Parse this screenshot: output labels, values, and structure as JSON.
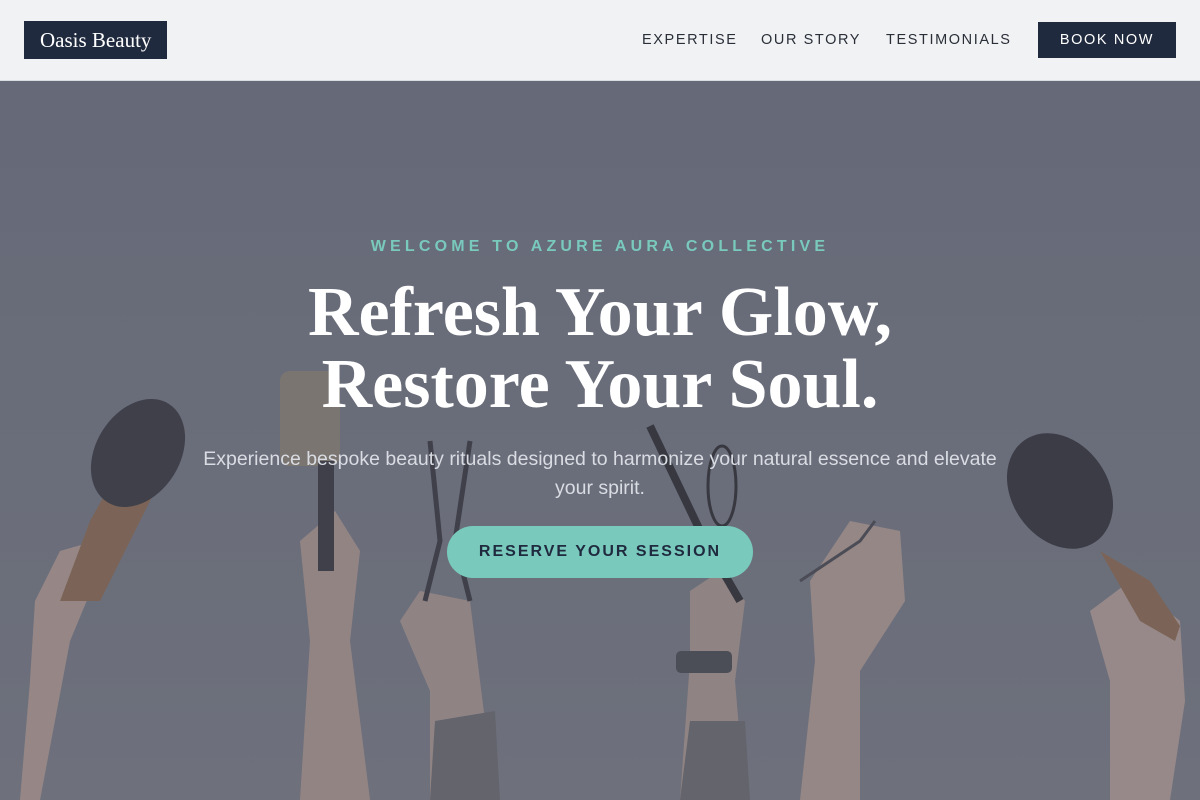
{
  "brand": {
    "name": "Oasis Beauty"
  },
  "nav": {
    "links": [
      "EXPERTISE",
      "OUR STORY",
      "TESTIMONIALS"
    ],
    "cta_label": "BOOK NOW"
  },
  "hero": {
    "eyebrow": "WELCOME TO AZURE AURA COLLECTIVE",
    "headline_line1": "Refresh Your Glow,",
    "headline_line2": "Restore Your Soul.",
    "subtext": "Experience bespoke beauty rituals designed to harmonize your natural essence and elevate your spirit.",
    "cta_label": "RESERVE YOUR SESSION",
    "background_image": "raised hands holding hair brushes, scissors and salon tools"
  },
  "colors": {
    "navy": "#1f2a3e",
    "accent_teal": "#79c9bd",
    "header_bg": "#f1f2f4"
  }
}
